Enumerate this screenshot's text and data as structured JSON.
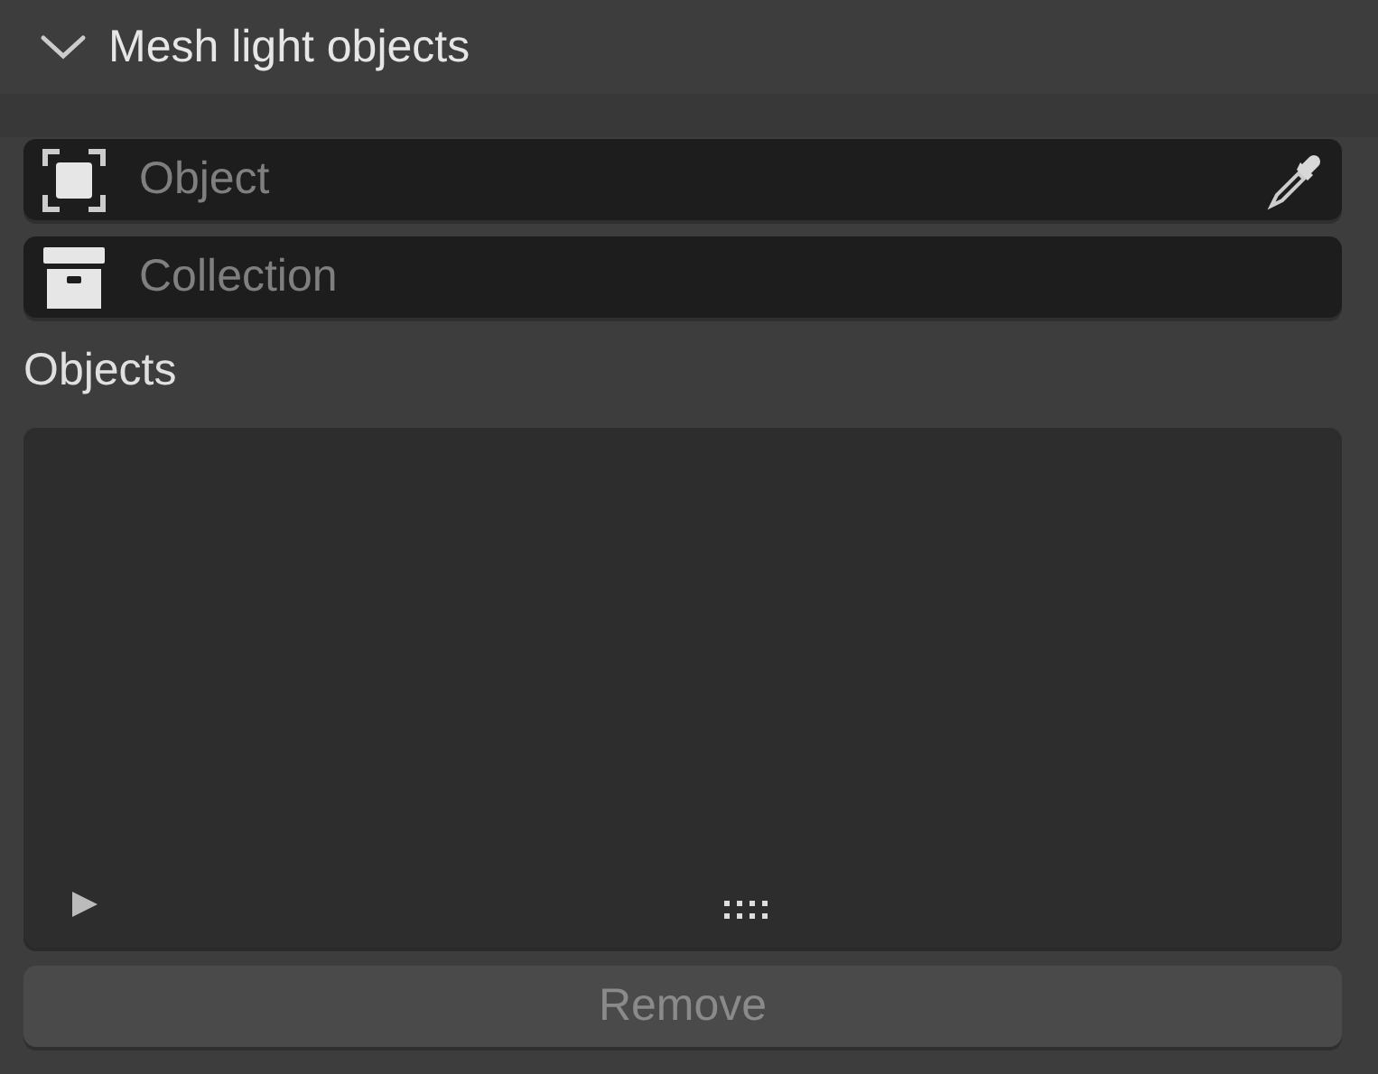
{
  "panel": {
    "title": "Mesh light objects",
    "expanded": true
  },
  "fields": [
    {
      "kind": "object",
      "placeholder": "Object",
      "eyedropper": true
    },
    {
      "kind": "collection",
      "placeholder": "Collection",
      "eyedropper": false
    }
  ],
  "list": {
    "label": "Objects"
  },
  "remove_button": {
    "label": "Remove",
    "disabled": true
  }
}
